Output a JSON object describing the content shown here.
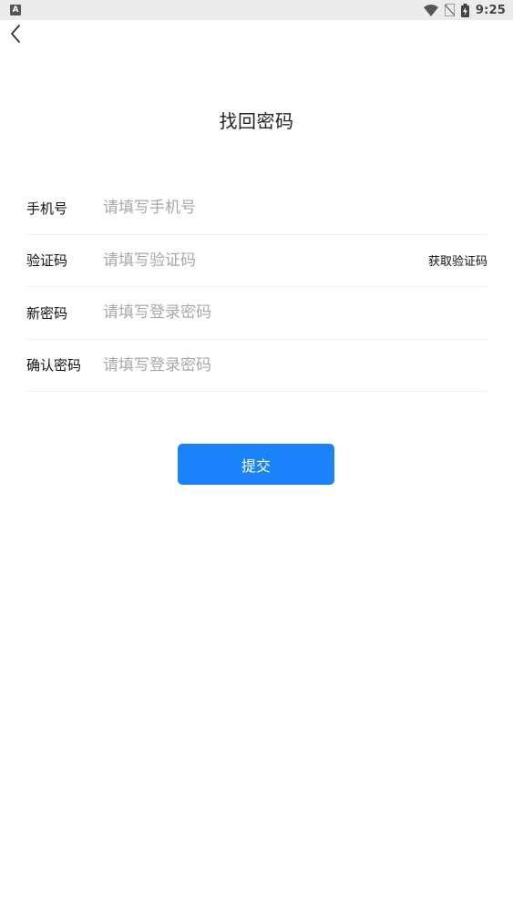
{
  "status_bar": {
    "notification_glyph": "A",
    "time": "9:25",
    "icons": [
      "wifi-icon",
      "no-sim-icon",
      "battery-charging-icon"
    ]
  },
  "header": {
    "title": "找回密码"
  },
  "form": {
    "phone": {
      "label": "手机号",
      "placeholder": "请填写手机号"
    },
    "code": {
      "label": "验证码",
      "placeholder": "请填写验证码",
      "get_code_label": "获取验证码"
    },
    "new_password": {
      "label": "新密码",
      "placeholder": "请填写登录密码"
    },
    "confirm_password": {
      "label": "确认密码",
      "placeholder": "请填写登录密码"
    }
  },
  "submit": {
    "label": "提交"
  },
  "colors": {
    "primary": "#1a82fb",
    "status_bar_bg": "#ececec",
    "divider": "#f0f0f0",
    "placeholder": "#a8a8a8"
  }
}
